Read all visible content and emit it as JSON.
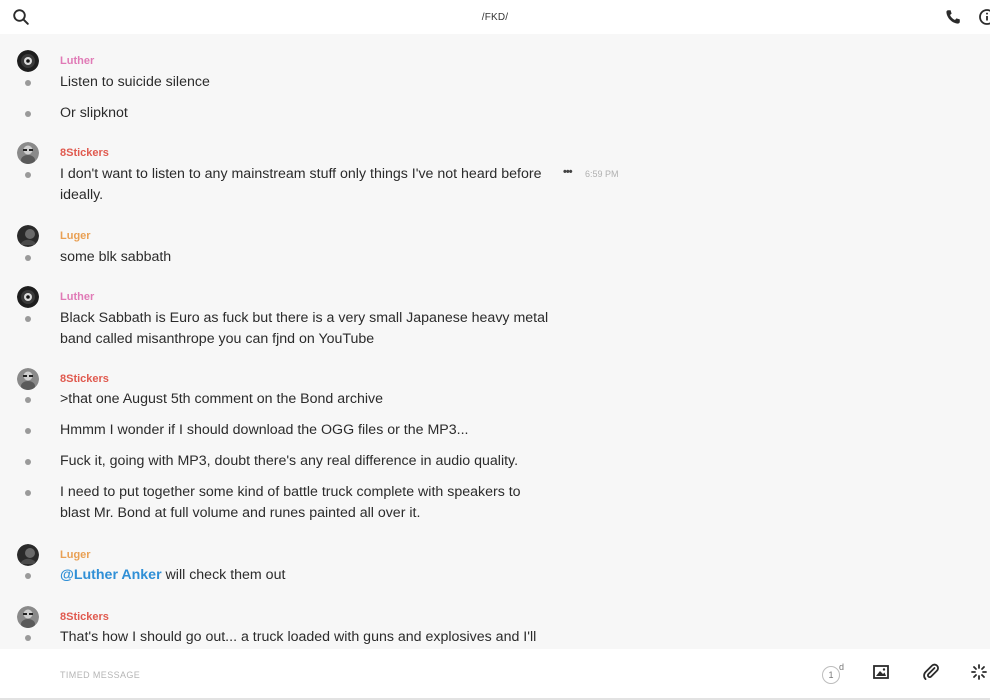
{
  "header": {
    "title": "/FKD/"
  },
  "messages": [
    {
      "sender": "Luther",
      "lines": [
        "Listen to suicide silence",
        "Or slipknot"
      ]
    },
    {
      "sender": "8Stickers",
      "lines": [
        "I don't want to listen to any mainstream stuff only things I've not heard before ideally."
      ],
      "time": "6:59 PM",
      "menu": "•••"
    },
    {
      "sender": "Luger",
      "lines": [
        "some blk sabbath"
      ]
    },
    {
      "sender": "Luther",
      "lines": [
        "Black Sabbath is Euro as fuck but there is a very small Japanese heavy metal band called misanthrope you can fjnd on YouTube"
      ]
    },
    {
      "sender": "8Stickers",
      "lines": [
        ">that one August 5th comment on the Bond archive",
        "Hmmm I wonder if I should download the OGG files or the MP3...",
        "Fuck it, going with MP3, doubt there's any real difference in audio quality.",
        "I need to put together some kind of battle truck complete with speakers to blast Mr. Bond at full volume and runes painted all over it."
      ]
    },
    {
      "sender": "Luger",
      "mention": "@Luther Anker",
      "lines": [
        " will check them out"
      ]
    },
    {
      "sender": "8Stickers",
      "lines": [
        "That's how I should go out... a truck loaded with guns and explosives and I'll"
      ]
    }
  ],
  "composer": {
    "placeholder": "TIMED MESSAGE",
    "timer_value": "1",
    "timer_unit": "d"
  },
  "colors": {
    "luther": "#e07ab6",
    "stickers": "#e05a4f",
    "luger": "#e9a054",
    "mention": "#2f8fd6"
  }
}
